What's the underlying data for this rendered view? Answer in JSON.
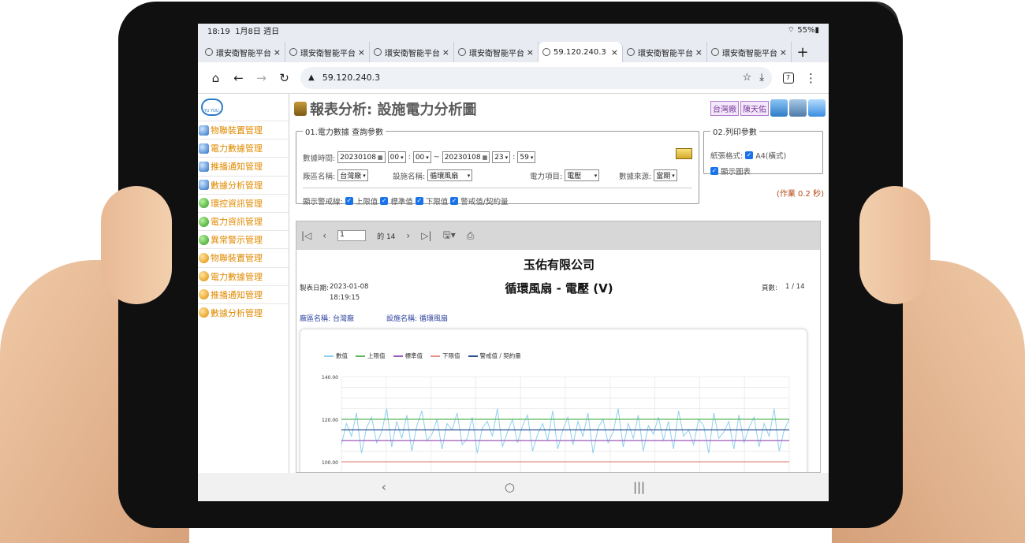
{
  "statusbar": {
    "time": "18:19",
    "date": "1月8日 週日",
    "battery": "55%"
  },
  "browser": {
    "tabs": [
      {
        "label": "環安衛智能平台:",
        "active": false
      },
      {
        "label": "環安衛智能平台:",
        "active": false
      },
      {
        "label": "環安衛智能平台:",
        "active": false
      },
      {
        "label": "環安衛智能平台:",
        "active": false
      },
      {
        "label": "59.120.240.3",
        "active": true
      },
      {
        "label": "環安衛智能平台:",
        "active": false
      },
      {
        "label": "環安衛智能平台:",
        "active": false
      }
    ],
    "close_glyph": "×",
    "newtab_glyph": "+",
    "url": "59.120.240.3",
    "tab_count": "7"
  },
  "sidebar": {
    "logo_text": "YU YOU.",
    "items": [
      {
        "label": "物聯裝置管理",
        "icon": "blue"
      },
      {
        "label": "電力數據管理",
        "icon": "blue"
      },
      {
        "label": "推播通知管理",
        "icon": "blue"
      },
      {
        "label": "數據分析管理",
        "icon": "blue"
      },
      {
        "label": "環控資訊管理",
        "icon": "green"
      },
      {
        "label": "電力資訊管理",
        "icon": "green"
      },
      {
        "label": "異常警示管理",
        "icon": "green"
      },
      {
        "label": "物聯裝置管理",
        "icon": "orange"
      },
      {
        "label": "電力數據管理",
        "icon": "orange"
      },
      {
        "label": "推播通知管理",
        "icon": "orange"
      },
      {
        "label": "數據分析管理",
        "icon": "orange"
      }
    ]
  },
  "header": {
    "title": "報表分析: 設施電力分析圖",
    "factory_tag": "台灣廠",
    "user_tag": "陳天佑"
  },
  "query": {
    "legend": "01.電力數據 查詢參數",
    "time_label": "數據時間:",
    "start_date": "20230108",
    "start_hour": "00",
    "start_min": "00",
    "range_sep": "~",
    "end_date": "20230108",
    "end_hour": "23",
    "end_min": "59",
    "colon": ":",
    "factory_label": "廠區名稱:",
    "factory_value": "台灣廠",
    "facility_label": "設施名稱:",
    "facility_value": "循環風扇",
    "item_label": "電力項目:",
    "item_value": "電壓",
    "source_label": "數據來源:",
    "source_value": "當期",
    "alarm_label": "顯示警戒線:",
    "alarm_upper": "上限值",
    "alarm_std": "標準值",
    "alarm_lower": "下限值",
    "alarm_contract": "警戒值/契約量"
  },
  "print": {
    "legend": "02.列印參數",
    "paper_label": "紙張格式:",
    "paper_value": "A4(橫式)",
    "show_chart": "顯示圖表"
  },
  "elapsed": "(作業 0.2 秒)",
  "viewer": {
    "page_current": "1",
    "page_of": "的 14"
  },
  "report": {
    "company": "玉佑有限公司",
    "title": "循環風扇 - 電壓 (V)",
    "date_label": "製表日期:",
    "date_value": "2023-01-08",
    "time_value": "18:19:15",
    "page_label": "頁數:",
    "page_value": "1 / 14",
    "factory_label": "廠區名稱:",
    "factory_value": "台灣廠",
    "facility_label": "設施名稱:",
    "facility_value": "循環風扇"
  },
  "chart_data": {
    "type": "line",
    "title": "",
    "xlabel": "",
    "ylabel": "",
    "ylim": [
      96,
      142
    ],
    "yticks": [
      "140.00",
      "120.00",
      "100.00"
    ],
    "legend_placement": "top-left",
    "grid": true,
    "series": [
      {
        "name": "數值",
        "color": "#8fd0ee",
        "values": [
          108,
          118,
          112,
          123,
          104,
          116,
          121,
          109,
          114,
          125,
          107,
          119,
          111,
          122,
          105,
          117,
          124,
          110,
          113,
          120,
          106,
          118,
          115,
          123,
          108,
          111,
          121,
          104,
          116,
          119,
          112,
          125,
          107,
          114,
          120,
          109,
          117,
          122,
          105,
          113,
          118,
          110,
          124,
          106,
          115,
          121,
          108,
          119,
          112,
          123,
          104,
          116,
          120,
          109,
          114,
          125,
          107,
          118,
          111,
          122,
          105,
          117,
          113,
          121,
          110,
          119,
          106,
          124,
          112,
          115,
          108,
          120,
          117,
          104,
          123,
          111,
          114,
          119,
          106,
          122,
          109,
          116,
          121,
          107,
          118,
          112,
          125,
          105,
          115,
          120
        ]
      },
      {
        "name": "上限值",
        "color": "#5cb85c",
        "values": [
          120
        ]
      },
      {
        "name": "標準值",
        "color": "#9b59b6",
        "values": [
          110
        ]
      },
      {
        "name": "下限值",
        "color": "#e8908a",
        "values": [
          100
        ]
      },
      {
        "name": "警戒值 / 契約量",
        "color": "#2d4f8f",
        "values": [
          115
        ]
      }
    ]
  },
  "colors": {
    "sidebar_text": "#e08a00",
    "accent_blue": "#1a73e8",
    "report_blue": "#2a3f9c"
  }
}
